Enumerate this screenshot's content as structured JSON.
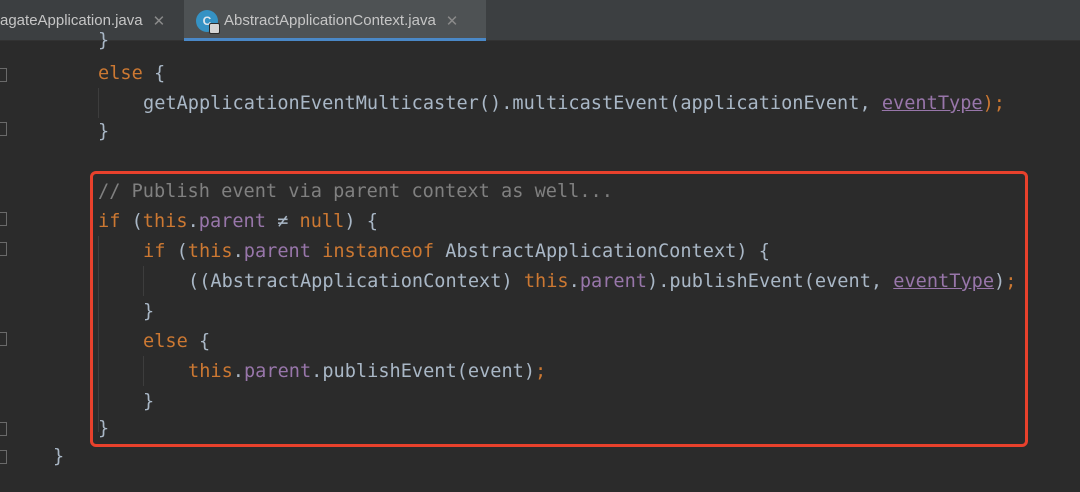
{
  "tabs": [
    {
      "label": "agateApplication.java",
      "active": false
    },
    {
      "label": "AbstractApplicationContext.java",
      "active": true,
      "icon": "class-c-icon"
    }
  ],
  "icons": {
    "close": "✕",
    "class_letter": "C"
  },
  "code": {
    "l0": "}",
    "l1_else": "else",
    "l1_brace": " {",
    "l2_call": "getApplicationEventMulticaster().multicastEvent(applicationEvent, ",
    "l2_arg": "eventType",
    "l2_end": ");",
    "l3": "}",
    "l5_comment": "// Publish event via parent context as well...",
    "l6_if": "if",
    "l6_open": " (",
    "l6_this": "this",
    "l6_dot": ".",
    "l6_parent": "parent",
    "l6_ne": " ≠ ",
    "l6_null": "null",
    "l6_end": ") {",
    "l7_if": "if",
    "l7_open": " (",
    "l7_this": "this",
    "l7_dot": ".",
    "l7_parent": "parent",
    "l7_instanceof": " instanceof",
    "l7_end": " AbstractApplicationContext) {",
    "l8_cast": "((AbstractApplicationContext) ",
    "l8_this": "this",
    "l8_dot": ".",
    "l8_parent": "parent",
    "l8_call": ").publishEvent(event, ",
    "l8_arg": "eventType",
    "l8_end": ")",
    "l8_semi": ";",
    "l9": "}",
    "l10_else": "else",
    "l10_brace": " {",
    "l11_this": "this",
    "l11_dot": ".",
    "l11_parent": "parent",
    "l11_call": ".publishEvent(event)",
    "l11_semi": ";",
    "l12": "}",
    "l13": "}",
    "l14": "}"
  },
  "colors": {
    "background": "#2b2b2b",
    "keyword": "#cc7832",
    "field": "#9876aa",
    "comment": "#808080",
    "text": "#a9b7c6",
    "highlight_border": "#e8412c"
  }
}
